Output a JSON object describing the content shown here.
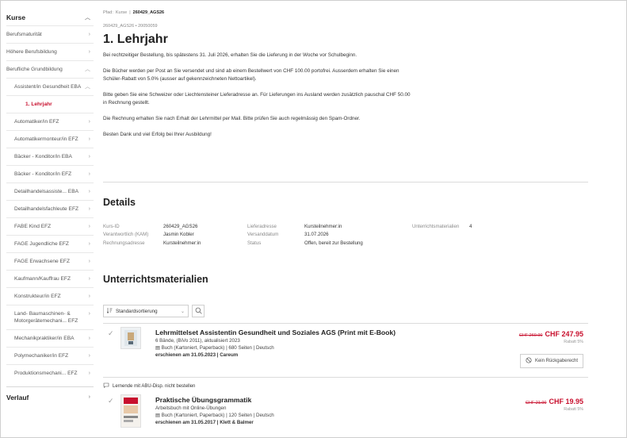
{
  "sidebar": {
    "kurse_title": "Kurse",
    "items": [
      {
        "label": "Berufsmaturität"
      },
      {
        "label": "Höhere Berufsbildung"
      },
      {
        "label": "Berufliche Grundbildung"
      },
      {
        "label": "Assistent/in Gesundheit EBA"
      },
      {
        "label": "1. Lehrjahr"
      },
      {
        "label": "Automatiker/in EFZ"
      },
      {
        "label": "Automatikermonteur/in EFZ"
      },
      {
        "label": "Bäcker - Konditor/in EBA"
      },
      {
        "label": "Bäcker - Konditor/in EFZ"
      },
      {
        "label": "Detailhandelsassiste... EBA"
      },
      {
        "label": "Detailhandelsfachleute EFZ"
      },
      {
        "label": "FABE Kind EFZ"
      },
      {
        "label": "FAGE Jugendliche EFZ"
      },
      {
        "label": "FAGE Erwachsene EFZ"
      },
      {
        "label": "Kaufmann/Kauffrau EFZ"
      },
      {
        "label": "Konstrukteur/in EFZ"
      },
      {
        "label": "Land- Baumaschinen- & Motorgerätemechani... EFZ"
      },
      {
        "label": "Mechanikpraktiker/in EBA"
      },
      {
        "label": "Polymechaniker/in EFZ"
      },
      {
        "label": "Produktionsmechani... EFZ"
      }
    ],
    "verlauf_title": "Verlauf"
  },
  "breadcrumb": {
    "first": "Pfad:",
    "second": "Kurse",
    "sep": "|",
    "current": "260429_AGS26"
  },
  "sub_id": "260429_AGS26 • 20050059",
  "page_title": "1. Lehrjahr",
  "paragraphs": [
    "Bei rechtzeitiger Bestellung, bis spätestens 31. Juli 2026, erhalten Sie die Lieferung in der Woche vor Schulbeginn.",
    "Die Bücher werden per Post an Sie versendet und sind ab einem Bestellwert von CHF 100.00 portofrei. Ausserdem erhalten Sie einen Schüler-Rabatt von 5.0% (ausser auf gekennzeichneten Nettoartikel).",
    "Bitte geben Sie eine Schweizer oder Liechtensteiner Lieferadresse an. Für Lieferungen ins Ausland werden zusätzlich pauschal CHF 50.00 in Rechnung gestellt.",
    "Die Rechnung erhalten Sie nach Erhalt der Lehrmittel per Mail. Bitte prüfen Sie auch regelmässig den Spam-Ordner.",
    "Besten Dank und viel Erfolg bei Ihrer Ausbildung!"
  ],
  "details": {
    "title": "Details",
    "col1": [
      {
        "k": "Kurs-ID",
        "v": "260429_AGS26"
      },
      {
        "k": "Verantwortlich (KAM)",
        "v": "Jasmin Kobler"
      },
      {
        "k": "Rechnungsadresse",
        "v": "Kursteilnehmer:in"
      }
    ],
    "col2": [
      {
        "k": "Lieferadresse",
        "v": "Kursteilnehmer:in"
      },
      {
        "k": "Versanddatum",
        "v": "31.07.2026"
      },
      {
        "k": "Status",
        "v": "Offen, bereit zur Bestellung"
      }
    ],
    "col3": [
      {
        "k": "Unterrichtsmaterialien",
        "v": "4"
      }
    ]
  },
  "materials": {
    "title": "Unterrichtsmaterialien",
    "sort_label": "Standardsortierung"
  },
  "products": [
    {
      "title": "Lehrmittelset Assistentin Gesundheit und Soziales AGS (Print mit E-Book)",
      "line1": "6 Bände, (BiVo 2011), aktualisiert 2023",
      "line2": "Buch (Kartoniert, Paperback) | 680 Seiten | Deutsch",
      "line3": "erschienen am 31.05.2023 | Careum",
      "old_price": "CHF 260.00",
      "price": "CHF 247.95",
      "rabatt": "Rabatt 5%",
      "badge": "Kein Rückgaberecht"
    },
    {
      "notice": "Lernende mit ABU-Disp. nicht bestellen",
      "title": "Praktische Übungsgrammatik",
      "line1": "Arbeitsbuch mit Online-Übungen",
      "line2": "Buch (Kartoniert, Paperback) | 120 Seiten | Deutsch",
      "line3": "erschienen am 31.05.2017 | Klett & Balmer",
      "old_price": "CHF 21.00",
      "price": "CHF 19.95",
      "rabatt": "Rabatt 5%"
    }
  ],
  "colors": {
    "accent": "#c8102e"
  }
}
